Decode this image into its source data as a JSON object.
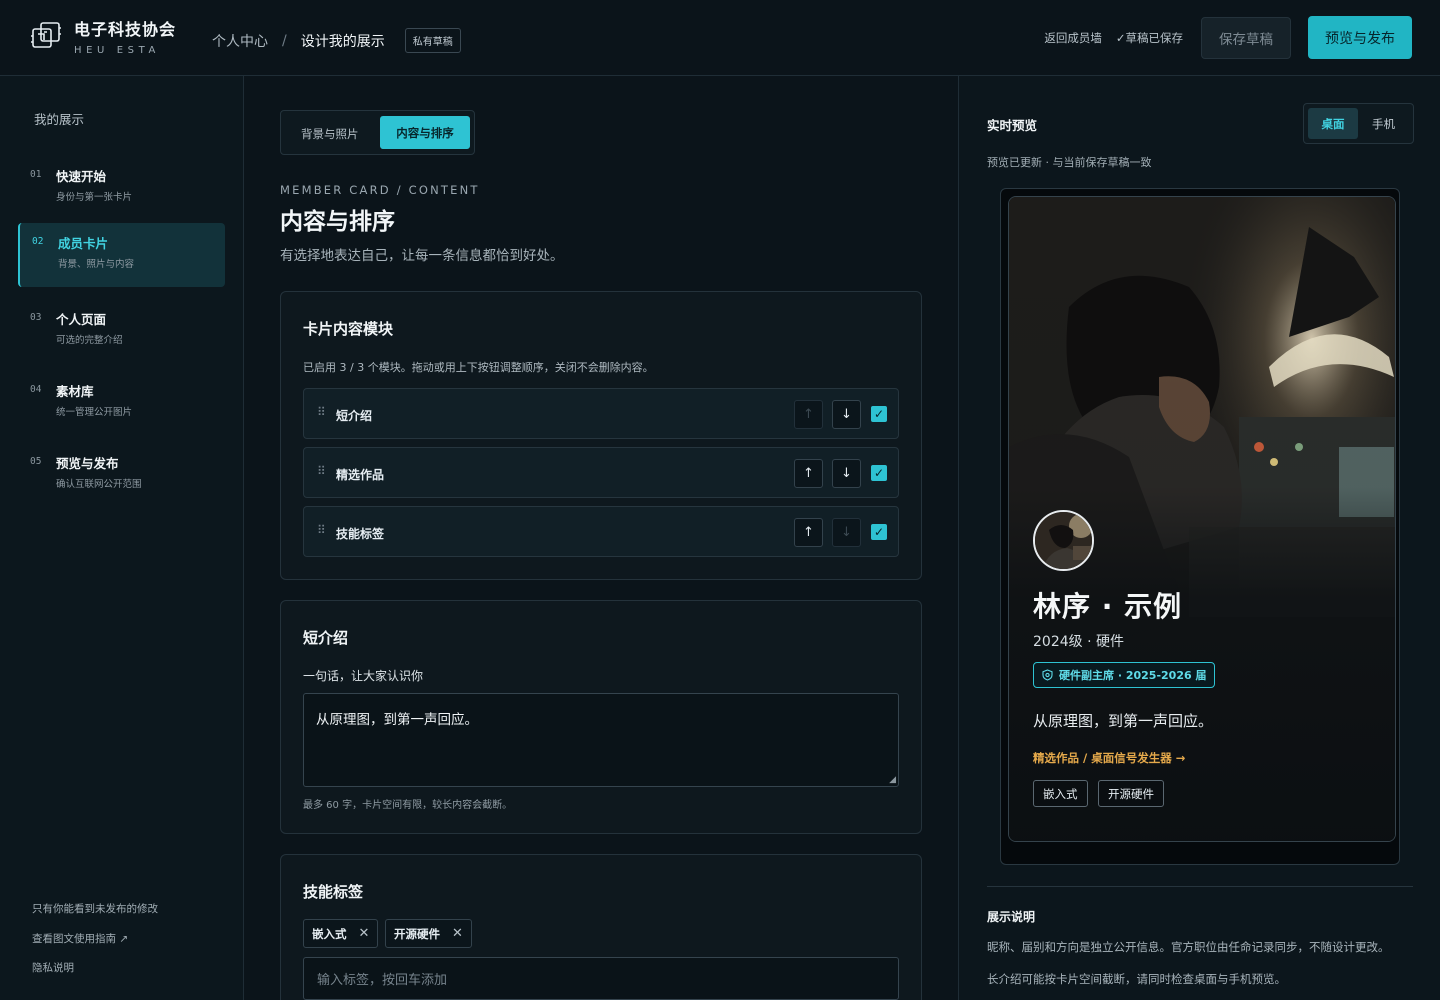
{
  "brand": {
    "name": "电子科技协会",
    "sub": "HEU ESTA"
  },
  "breadcrumb": {
    "parent": "个人中心",
    "separator": "/",
    "current": "设计我的展示",
    "badge": "私有草稿"
  },
  "topbar": {
    "back": "返回成员墙",
    "saved": "✓草稿已保存",
    "save_draft": "保存草稿",
    "publish": "预览与发布"
  },
  "sidebar": {
    "title": "我的展示",
    "steps": [
      {
        "num": "01",
        "title": "快速开始",
        "sub": "身份与第一张卡片"
      },
      {
        "num": "02",
        "title": "成员卡片",
        "sub": "背景、照片与内容"
      },
      {
        "num": "03",
        "title": "个人页面",
        "sub": "可选的完整介绍"
      },
      {
        "num": "04",
        "title": "素材库",
        "sub": "统一管理公开图片"
      },
      {
        "num": "05",
        "title": "预览与发布",
        "sub": "确认互联网公开范围"
      }
    ],
    "footer": {
      "note": "只有你能看到未发布的修改",
      "guide": "查看图文使用指南 ↗",
      "privacy": "隐私说明"
    }
  },
  "main": {
    "tabs": {
      "bg": "背景与照片",
      "content": "内容与排序"
    },
    "eyebrow": "MEMBER CARD / CONTENT",
    "title": "内容与排序",
    "lead": "有选择地表达自己，让每一条信息都恰到好处。",
    "modules": {
      "title": "卡片内容模块",
      "note": "已启用 3 / 3 个模块。拖动或用上下按钮调整顺序，关闭不会删除内容。",
      "items": [
        {
          "name": "短介绍",
          "up_enabled": false,
          "down_enabled": true,
          "checked": true
        },
        {
          "name": "精选作品",
          "up_enabled": true,
          "down_enabled": true,
          "checked": true
        },
        {
          "name": "技能标签",
          "up_enabled": true,
          "down_enabled": false,
          "checked": true
        }
      ]
    },
    "intro": {
      "title": "短介绍",
      "label": "一句话，让大家认识你",
      "value": "从原理图，到第一声回应。",
      "hint": "最多 60 字，卡片空间有限，较长内容会截断。"
    },
    "skills": {
      "title": "技能标签",
      "tags": [
        "嵌入式",
        "开源硬件"
      ],
      "placeholder": "输入标签，按回车添加"
    }
  },
  "preview": {
    "title": "实时预览",
    "device_desktop": "桌面",
    "device_mobile": "手机",
    "status": "预览已更新 · 与当前保存草稿一致",
    "card": {
      "name": "林序 · 示例",
      "meta": "2024级 · 硬件",
      "role": "硬件副主席 · 2025-2026 届",
      "quote": "从原理图，到第一声回应。",
      "work": "精选作品 / 桌面信号发生器 →",
      "tags": [
        "嵌入式",
        "开源硬件"
      ]
    },
    "explain": {
      "title": "展示说明",
      "line1": "昵称、届别和方向是独立公开信息。官方职位由任命记录同步，不随设计更改。",
      "line2": "长介绍可能按卡片空间截断，请同时检查桌面与手机预览。"
    }
  },
  "colors": {
    "accent": "#2ec3d3",
    "work_link": "#e5a94b",
    "background": "#0b141a"
  }
}
